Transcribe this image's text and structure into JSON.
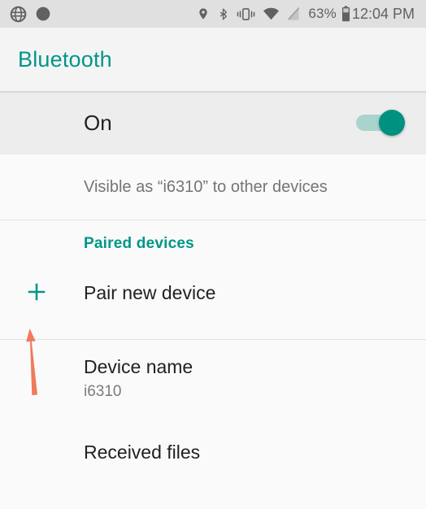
{
  "statusbar": {
    "left_icons": [
      {
        "name": "globe-network-icon"
      },
      {
        "name": "circle-dot-icon"
      }
    ],
    "right_icons": [
      {
        "name": "location-pin-icon"
      },
      {
        "name": "bluetooth-icon"
      },
      {
        "name": "vibrate-icon"
      },
      {
        "name": "wifi-icon"
      },
      {
        "name": "no-signal-icon"
      }
    ],
    "battery_percent": "63%",
    "battery_icon": "battery-icon",
    "time": "12:04 PM"
  },
  "appbar": {
    "title": "Bluetooth"
  },
  "master_switch": {
    "label": "On",
    "state": "on"
  },
  "visibility": {
    "text": "Visible as “i6310” to other devices"
  },
  "paired_section": {
    "header": "Paired devices",
    "pair_new_device": {
      "label": "Pair new device",
      "icon": "plus-icon"
    }
  },
  "device_name_row": {
    "title": "Device name",
    "value": "i6310"
  },
  "received_files_row": {
    "title": "Received files"
  },
  "annotation": {
    "name": "arrow-pointing-to-plus-icon",
    "color": "#f07a5a"
  },
  "colors": {
    "accent_teal": "#009688",
    "switch_thumb": "#009180",
    "switch_track": "#a9d4ce",
    "statusbar_bg": "#e0e0e0",
    "appbar_bg": "#f4f4f4",
    "switch_row_bg": "#ededed",
    "page_bg": "#fafafa",
    "annotation_orange": "#f07a5a"
  }
}
